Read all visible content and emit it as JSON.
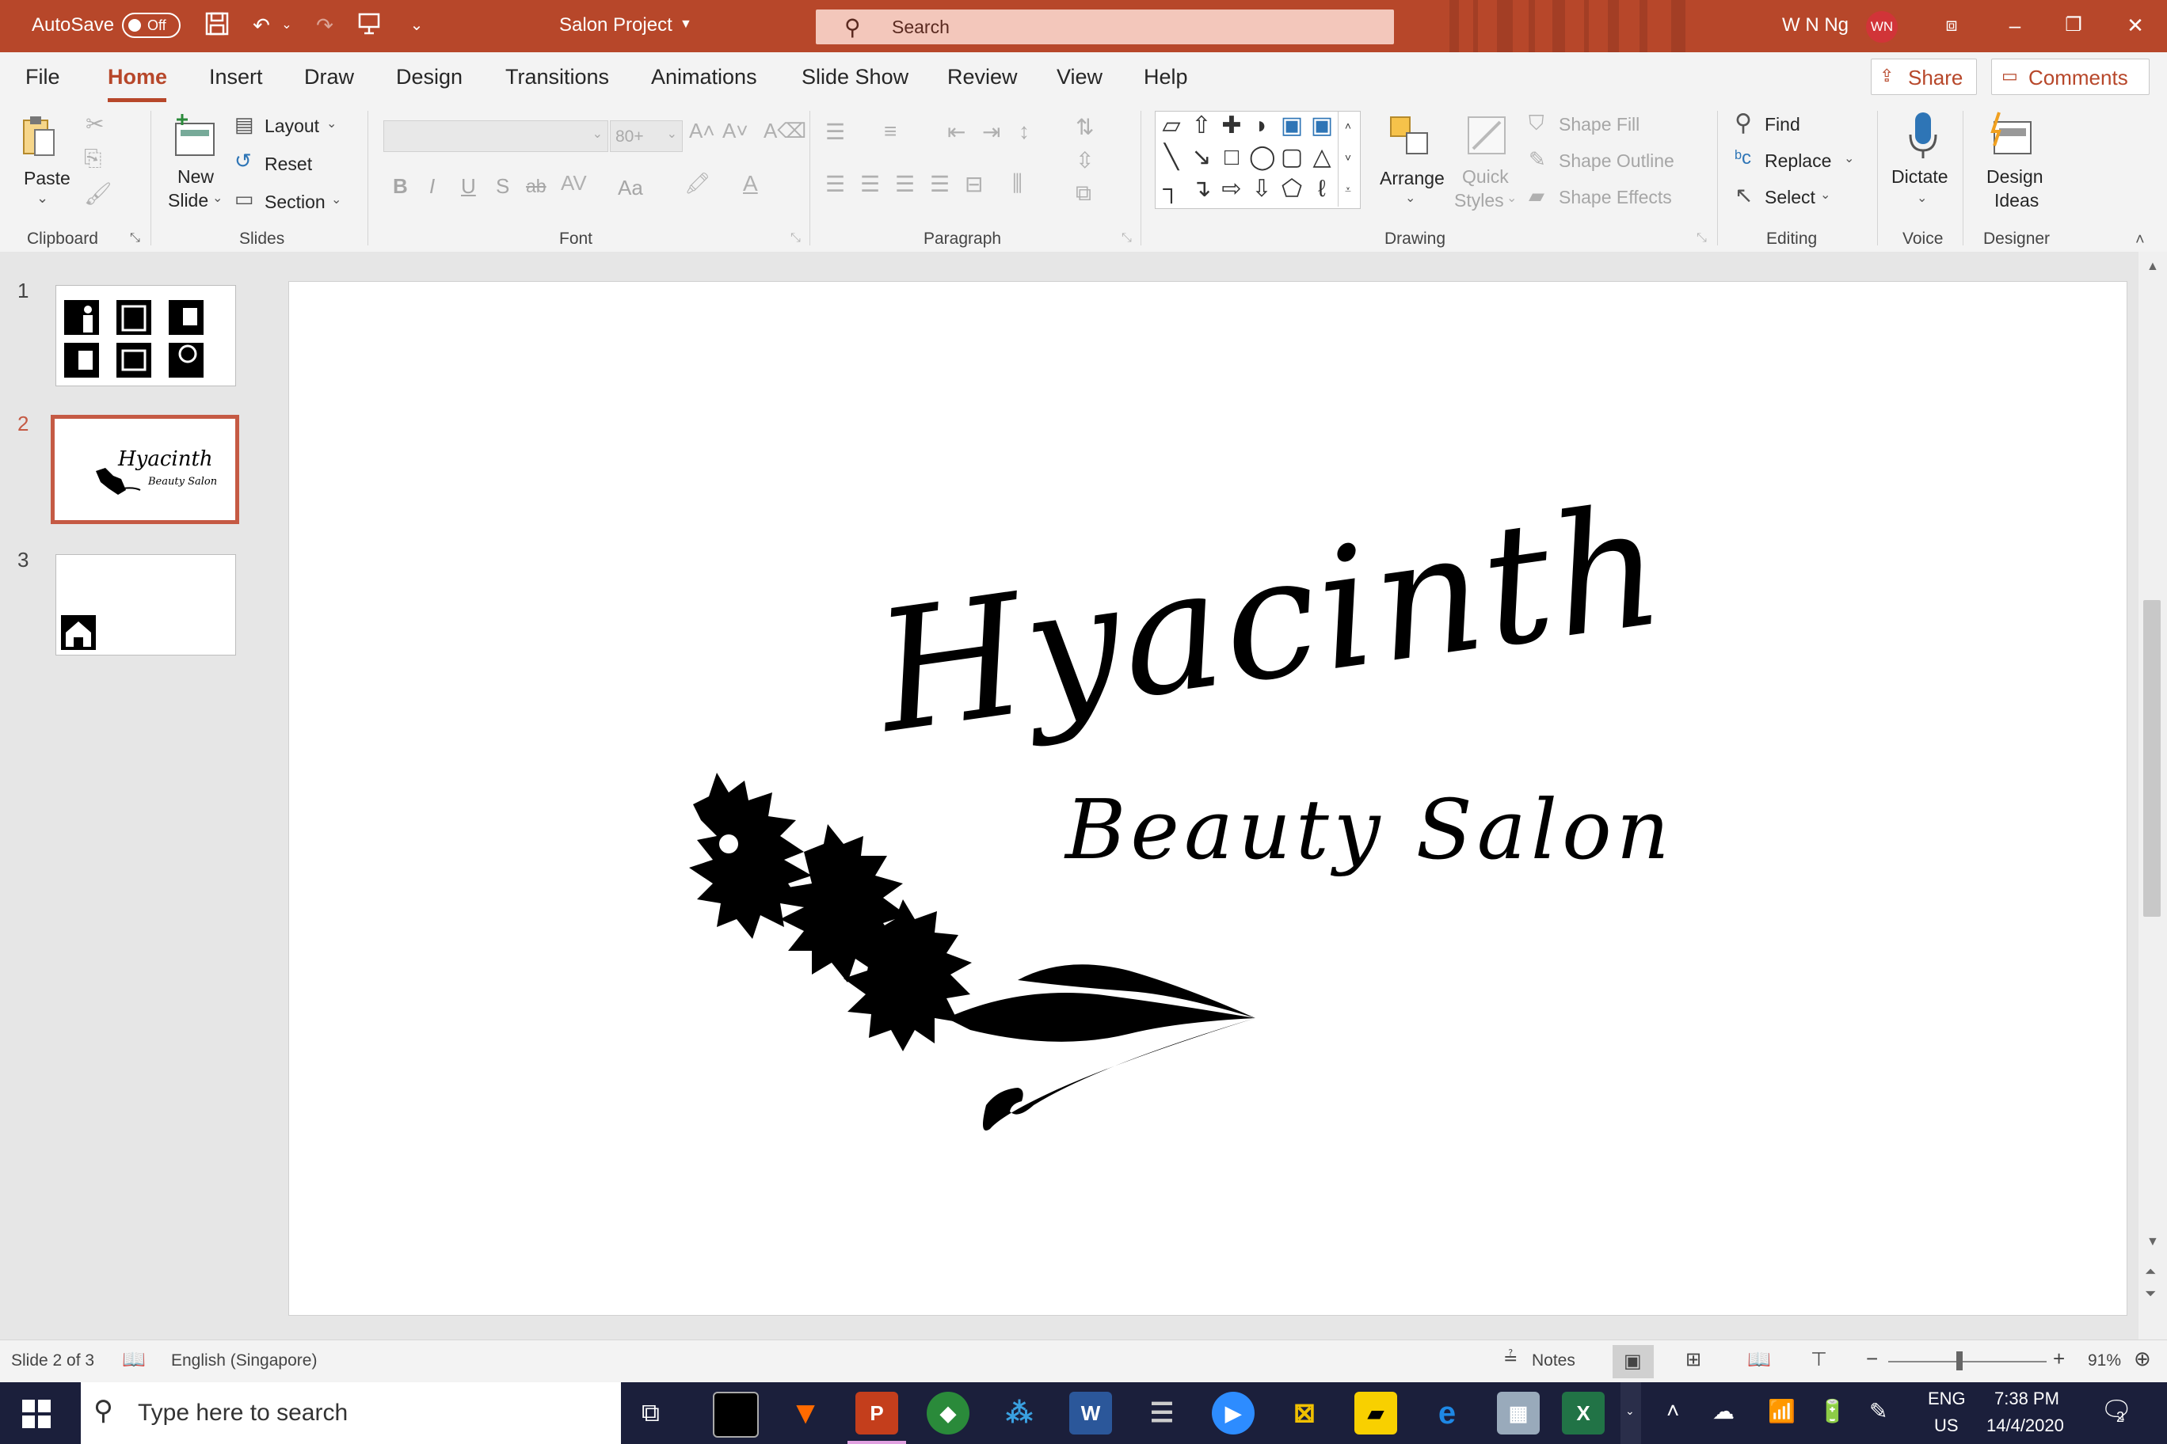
{
  "titlebar": {
    "autosave_label": "AutoSave",
    "autosave_state": "Off",
    "document_title": "Salon Project",
    "search_placeholder": "Search",
    "user_name": "W N Ng",
    "user_initials": "WN"
  },
  "menu": {
    "tabs": [
      "File",
      "Home",
      "Insert",
      "Draw",
      "Design",
      "Transitions",
      "Animations",
      "Slide Show",
      "Review",
      "View",
      "Help"
    ],
    "active_tab": "Home",
    "share_label": "Share",
    "comments_label": "Comments"
  },
  "ribbon": {
    "clipboard": {
      "paste": "Paste",
      "group": "Clipboard"
    },
    "slides": {
      "new_slide_1": "New",
      "new_slide_2": "Slide",
      "layout": "Layout",
      "reset": "Reset",
      "section": "Section",
      "group": "Slides"
    },
    "font": {
      "size": "80+",
      "bold": "B",
      "italic": "I",
      "underline": "U",
      "shadow": "S",
      "strike": "ab",
      "aa": "Aa",
      "group": "Font"
    },
    "paragraph": {
      "group": "Paragraph"
    },
    "drawing": {
      "arrange": "Arrange",
      "quick_styles_1": "Quick",
      "quick_styles_2": "Styles",
      "shape_fill": "Shape Fill",
      "shape_outline": "Shape Outline",
      "shape_effects": "Shape Effects",
      "group": "Drawing"
    },
    "editing": {
      "find": "Find",
      "replace": "Replace",
      "select": "Select",
      "group": "Editing"
    },
    "voice": {
      "dictate": "Dictate",
      "group": "Voice"
    },
    "designer": {
      "design_ideas_1": "Design",
      "design_ideas_2": "Ideas",
      "group": "Designer"
    }
  },
  "thumbnails": [
    {
      "number": "1"
    },
    {
      "number": "2",
      "title": "Hyacinth",
      "subtitle": "Beauty Salon"
    },
    {
      "number": "3"
    }
  ],
  "slide": {
    "title": "Hyacinth",
    "subtitle": "Beauty Salon"
  },
  "statusbar": {
    "slide_info": "Slide 2 of 3",
    "language": "English (Singapore)",
    "notes": "Notes",
    "zoom_minus": "−",
    "zoom_plus": "+",
    "zoom": "91%"
  },
  "taskbar": {
    "search_placeholder": "Type here to search",
    "lang_1": "ENG",
    "lang_2": "US",
    "time": "7:38 PM",
    "date": "14/4/2020",
    "notification_count": "2"
  }
}
